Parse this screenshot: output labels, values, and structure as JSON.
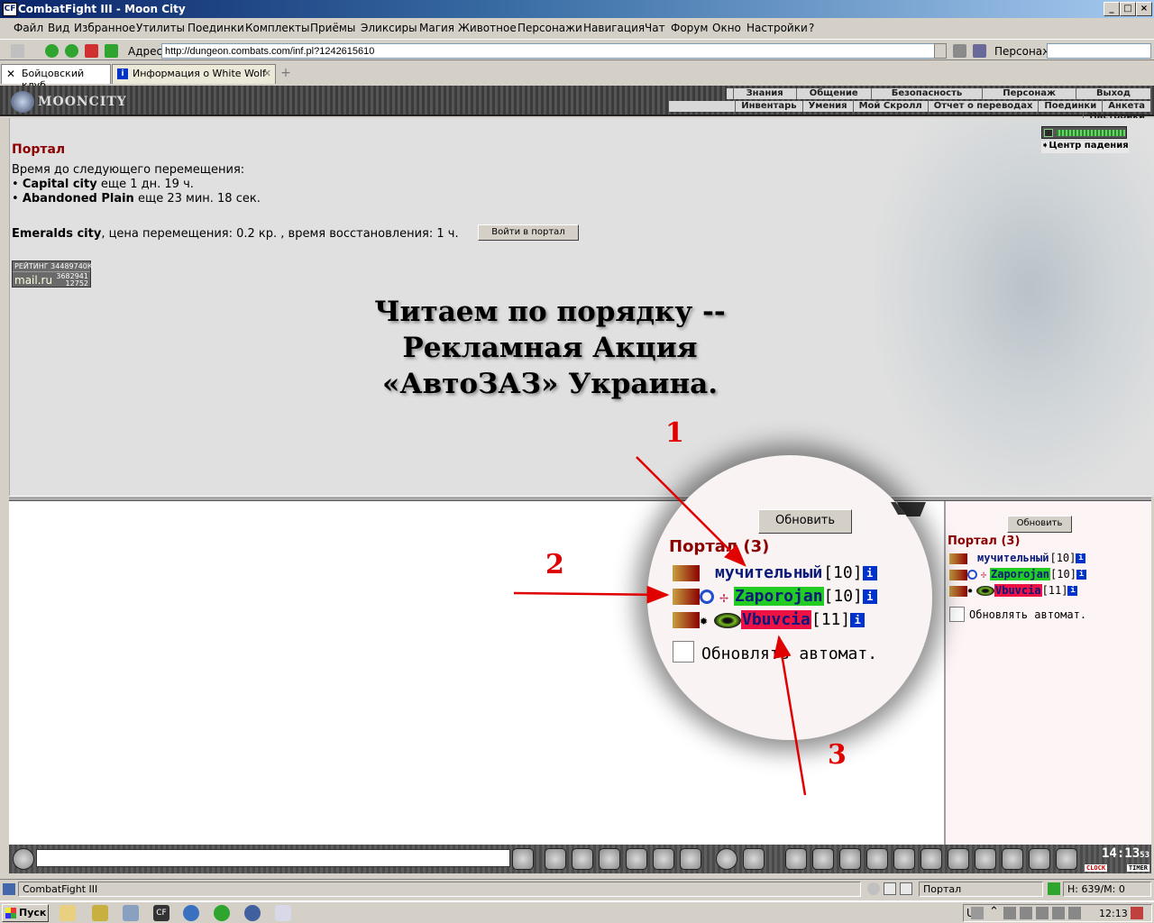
{
  "window": {
    "title": "CombatFight III - Moon City",
    "app_icon": "CF"
  },
  "menu": [
    "Файл",
    "Вид",
    "Избранное",
    "Утилиты",
    "Поединки",
    "Комплекты",
    "Приёмы",
    "Эликсиры",
    "Магия",
    "Животное",
    "Персонажи",
    "Навигация",
    "Чат",
    "Форум",
    "Окно",
    "Настройки",
    "?"
  ],
  "address": {
    "label": "Адрес:",
    "value": "http://dungeon.combats.com/inf.pl?1242615610",
    "person_label": "Персонаж:"
  },
  "tabs": [
    {
      "label": "Бойцовский клуб"
    },
    {
      "label": "Информация о White Wolf"
    }
  ],
  "game": {
    "logo": "MOONCITY",
    "top_links": [
      "Знания",
      "Общение",
      "Безопасность",
      "Персонаж",
      "Выход"
    ],
    "sub_links": [
      "Инвентарь",
      "Умения",
      "Мой Скролл",
      "Отчет о переводах",
      "Поединки",
      "Анкета",
      "Настройки"
    ],
    "fall_center": "Центр падения"
  },
  "portal": {
    "title": "Портал",
    "timer_label": "Время до следующего перемещения:",
    "destinations": [
      {
        "name": "Capital city",
        "time": "еще 1 дн. 19 ч."
      },
      {
        "name": "Abandoned Plain",
        "time": "еще 23 мин. 18 сек."
      }
    ],
    "current_city": "Emeralds city",
    "price_text": ", цена перемещения: 0.2 кр. , время восстановления: 1 ч.",
    "enter_button": "Войти в портал",
    "rating_line1": "РЕЙТИНГ 344897",
    "rating_line1b": "40К",
    "rating_line2": "mail.ru",
    "rating_n1": "3682941",
    "rating_n2": "12752"
  },
  "overlay_text": [
    "Читаем по порядку --",
    "Рекламная Акция",
    "«АвтоЗАЗ» Украина."
  ],
  "online": {
    "refresh_label": "Обновить",
    "title": "Портал (3)",
    "players": [
      {
        "name": "мучительный",
        "level": "[10]",
        "bg": "",
        "color": "#0a1a7a"
      },
      {
        "name": "Zaporojan",
        "level": "[10]",
        "bg": "#22cc22",
        "color": "#0a1a7a"
      },
      {
        "name": "Vbuvcia",
        "level": "[11]",
        "bg": "#ee1144",
        "color": "#0a1a7a"
      }
    ],
    "auto_refresh_label": "Обновлять автомат."
  },
  "annotations": [
    "1",
    "2",
    "3"
  ],
  "clock": {
    "time": "14:13",
    "seconds": "53",
    "label_clock": "CLOCK",
    "label_timer": "TIMER"
  },
  "status": {
    "app": "CombatFight III",
    "location": "Портал",
    "hp": "Н: 639/М: 0"
  },
  "taskbar": {
    "start": "Пуск",
    "lang": "UK",
    "time": "12:13"
  },
  "colors": {
    "accent_red": "#8b0000",
    "annotation": "#e00000",
    "info_blue": "#0033cc"
  }
}
